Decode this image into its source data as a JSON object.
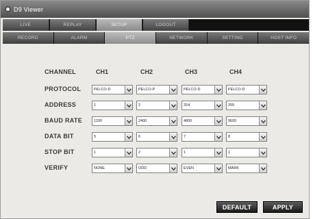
{
  "window": {
    "title": "D9 Viewer"
  },
  "main_tabs": [
    {
      "label": "LIVE"
    },
    {
      "label": "REPLAY"
    },
    {
      "label": "SETUP",
      "active": true
    },
    {
      "label": "LOGOUT"
    }
  ],
  "sub_tabs": [
    {
      "label": "RECORD"
    },
    {
      "label": "ALARM"
    },
    {
      "label": "PTZ",
      "active": true
    },
    {
      "label": "NETWORK"
    },
    {
      "label": "SETTING"
    },
    {
      "label": "HOST INFO"
    }
  ],
  "ptz": {
    "channel_label": "CHANNEL",
    "channels": [
      "CH1",
      "CH2",
      "CH3",
      "CH4"
    ],
    "rows": [
      {
        "label": "PROTOCOL",
        "values": [
          "PELCO-D",
          "PELCO-P",
          "PELCO-D",
          "PELCO-D"
        ]
      },
      {
        "label": "ADDRESS",
        "values": [
          "1",
          "2",
          "254",
          "255"
        ]
      },
      {
        "label": "BAUD RATE",
        "values": [
          "1200",
          "2400",
          "4800",
          "9600"
        ]
      },
      {
        "label": "DATA BIT",
        "values": [
          "5",
          "6",
          "7",
          "8"
        ]
      },
      {
        "label": "STOP BIT",
        "values": [
          "1",
          "2",
          "1",
          "1"
        ]
      },
      {
        "label": "VERIFY",
        "values": [
          "NONE",
          "ODD",
          "EVEN",
          "MARK"
        ]
      }
    ]
  },
  "buttons": {
    "default_label": "DEFAULT",
    "apply_label": "APPLY"
  },
  "icons": {
    "app": "app-icon",
    "dropdown": "chevron-down-icon"
  },
  "colors": {
    "tab_bar": "#111111",
    "panel": "#eceae6",
    "active_tab": "#a5a5a5"
  }
}
